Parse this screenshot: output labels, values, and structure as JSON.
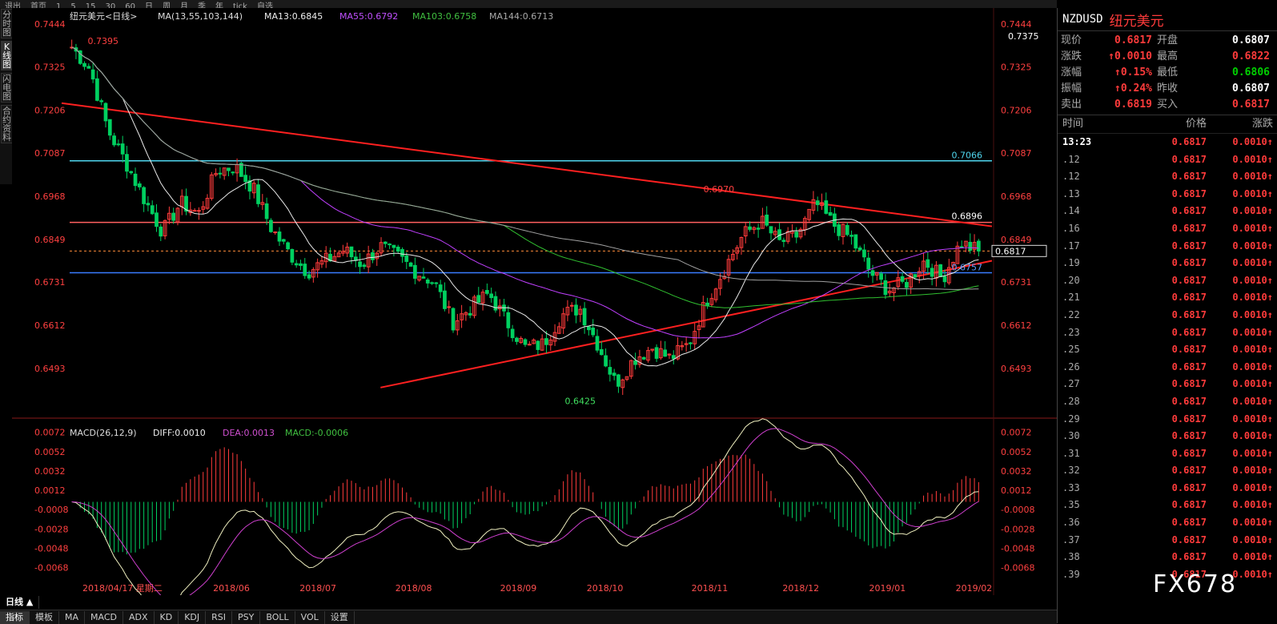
{
  "toolbar": {
    "items": [
      "退出",
      "首页",
      "1",
      "5",
      "15",
      "30",
      "60",
      "日",
      "周",
      "月",
      "季",
      "年",
      "tick",
      "",
      "",
      "",
      "",
      "",
      "",
      "",
      "",
      "",
      "",
      "",
      "自选",
      "",
      "",
      "",
      "",
      "",
      "",
      "",
      "",
      "",
      "",
      "",
      "",
      "",
      "",
      "",
      "",
      "",
      "",
      "",
      "",
      "",
      "",
      "",
      "",
      "",
      "",
      "",
      "",
      "",
      "",
      "",
      "",
      "",
      "",
      "",
      "",
      "",
      "",
      "",
      "",
      "",
      "",
      "",
      "",
      "",
      "",
      "",
      "",
      "",
      "",
      "",
      "",
      "",
      "",
      "",
      "",
      "",
      "",
      "",
      "",
      "",
      "",
      "",
      "",
      "",
      "",
      "",
      "",
      "",
      "",
      "",
      "",
      "",
      "",
      "",
      "",
      "",
      "",
      "",
      "",
      "",
      "",
      "",
      "",
      "",
      "",
      "",
      "",
      "",
      "",
      "",
      "",
      "",
      "",
      "",
      "",
      "",
      "",
      "",
      "",
      "",
      "",
      "",
      "",
      "",
      "",
      "",
      "",
      "",
      "",
      "",
      ""
    ]
  },
  "sidebar": {
    "items": [
      "分时图",
      "K线图",
      "闪电图",
      "合约资料"
    ],
    "active_index": 1
  },
  "main_header": {
    "symbol_name": "纽元美元<日线>",
    "ma_label": "MA(13,55,103,144)",
    "ma13": "MA13:0.6845",
    "ma55": "MA55:0.6792",
    "ma103": "MA103:0.6758",
    "ma144": "MA144:0.6713"
  },
  "macd_header": {
    "label": "MACD(26,12,9)",
    "diff": "DIFF:0.0010",
    "dea": "DEA:0.0013",
    "macd": "MACD:-0.0006"
  },
  "chart_data": {
    "type": "candlestick",
    "price_axis_ticks": [
      0.7444,
      0.7325,
      0.7206,
      0.7087,
      0.6968,
      0.6849,
      0.6731,
      0.6612,
      0.6493
    ],
    "price_range": [
      0.636,
      0.747
    ],
    "macd_axis_ticks": [
      0.0072,
      0.0052,
      0.0032,
      0.0012,
      -0.0008,
      -0.0028,
      -0.0048,
      -0.0068
    ],
    "macd_range": [
      -0.008,
      0.008
    ],
    "x_axis_labels": [
      "2018/04/17 星期二",
      "2018/06",
      "2018/07",
      "2018/08",
      "2018/09",
      "2018/10",
      "2018/11",
      "2018/12",
      "2019/01",
      "2019/02"
    ],
    "annotations": {
      "high": "0.7395",
      "low": "0.6425",
      "peak": "0.6970",
      "resistance_label": "0.6896",
      "support_label": "0.6757",
      "cyan_label": "0.7066",
      "right_label_7375": "0.7375",
      "current_price": "0.6817"
    },
    "horizontal_lines": [
      {
        "price": 0.7066,
        "color": "#4fd6ef"
      },
      {
        "price": 0.6896,
        "color": "#ff6060"
      },
      {
        "price": 0.6757,
        "color": "#3a7cff"
      },
      {
        "price": 0.6817,
        "color": "#ff8a3a",
        "style": "dashed"
      }
    ],
    "trend_lines": [
      {
        "from": [
          0,
          0.7225
        ],
        "to": [
          1,
          0.6885
        ],
        "color": "#ff2020"
      },
      {
        "from": [
          0.35,
          0.644
        ],
        "to": [
          1,
          0.679
        ],
        "color": "#ff2020"
      }
    ],
    "close_anchors": [
      [
        0.0,
        0.738
      ],
      [
        0.02,
        0.732
      ],
      [
        0.04,
        0.715
      ],
      [
        0.06,
        0.706
      ],
      [
        0.08,
        0.696
      ],
      [
        0.1,
        0.687
      ],
      [
        0.12,
        0.695
      ],
      [
        0.14,
        0.692
      ],
      [
        0.16,
        0.704
      ],
      [
        0.18,
        0.705
      ],
      [
        0.2,
        0.699
      ],
      [
        0.22,
        0.688
      ],
      [
        0.24,
        0.681
      ],
      [
        0.26,
        0.676
      ],
      [
        0.28,
        0.679
      ],
      [
        0.3,
        0.682
      ],
      [
        0.32,
        0.678
      ],
      [
        0.34,
        0.683
      ],
      [
        0.36,
        0.68
      ],
      [
        0.38,
        0.676
      ],
      [
        0.4,
        0.673
      ],
      [
        0.42,
        0.662
      ],
      [
        0.44,
        0.666
      ],
      [
        0.46,
        0.67
      ],
      [
        0.48,
        0.662
      ],
      [
        0.5,
        0.655
      ],
      [
        0.52,
        0.656
      ],
      [
        0.54,
        0.664
      ],
      [
        0.56,
        0.666
      ],
      [
        0.58,
        0.656
      ],
      [
        0.6,
        0.645
      ],
      [
        0.62,
        0.652
      ],
      [
        0.64,
        0.655
      ],
      [
        0.66,
        0.652
      ],
      [
        0.68,
        0.656
      ],
      [
        0.7,
        0.668
      ],
      [
        0.72,
        0.677
      ],
      [
        0.74,
        0.686
      ],
      [
        0.76,
        0.69
      ],
      [
        0.78,
        0.684
      ],
      [
        0.8,
        0.686
      ],
      [
        0.82,
        0.695
      ],
      [
        0.84,
        0.689
      ],
      [
        0.86,
        0.685
      ],
      [
        0.88,
        0.676
      ],
      [
        0.9,
        0.671
      ],
      [
        0.92,
        0.673
      ],
      [
        0.94,
        0.679
      ],
      [
        0.96,
        0.674
      ],
      [
        0.98,
        0.684
      ],
      [
        1.0,
        0.6817
      ]
    ],
    "candle_count": 215
  },
  "right_panel": {
    "symbol": "NZDUSD",
    "name": "纽元美元",
    "quote": [
      {
        "l1": "现价",
        "v1": "0.6817",
        "c1": "red",
        "l2": "开盘",
        "v2": "0.6807",
        "c2": "white"
      },
      {
        "l1": "涨跌",
        "v1": "↑0.0010",
        "c1": "red",
        "l2": "最高",
        "v2": "0.6822",
        "c2": "red"
      },
      {
        "l1": "涨幅",
        "v1": "↑0.15%",
        "c1": "red",
        "l2": "最低",
        "v2": "0.6806",
        "c2": "green"
      },
      {
        "l1": "振幅",
        "v1": "↑0.24%",
        "c1": "red",
        "l2": "昨收",
        "v2": "0.6807",
        "c2": "white"
      },
      {
        "l1": "卖出",
        "v1": "0.6819",
        "c1": "red",
        "l2": "买入",
        "v2": "0.6817",
        "c2": "red"
      }
    ],
    "ticks_header": {
      "time": "时间",
      "price": "价格",
      "change": "涨跌"
    },
    "ticks": [
      {
        "t": "13:23",
        "p": "0.6817",
        "c": "0.0010↑"
      },
      {
        "t": ".12",
        "p": "0.6817",
        "c": "0.0010↑"
      },
      {
        "t": ".12",
        "p": "0.6817",
        "c": "0.0010↑"
      },
      {
        "t": ".13",
        "p": "0.6817",
        "c": "0.0010↑"
      },
      {
        "t": ".14",
        "p": "0.6817",
        "c": "0.0010↑"
      },
      {
        "t": ".16",
        "p": "0.6817",
        "c": "0.0010↑"
      },
      {
        "t": ".17",
        "p": "0.6817",
        "c": "0.0010↑"
      },
      {
        "t": ".19",
        "p": "0.6817",
        "c": "0.0010↑"
      },
      {
        "t": ".20",
        "p": "0.6817",
        "c": "0.0010↑"
      },
      {
        "t": ".21",
        "p": "0.6817",
        "c": "0.0010↑"
      },
      {
        "t": ".22",
        "p": "0.6817",
        "c": "0.0010↑"
      },
      {
        "t": ".23",
        "p": "0.6817",
        "c": "0.0010↑"
      },
      {
        "t": ".25",
        "p": "0.6817",
        "c": "0.0010↑"
      },
      {
        "t": ".26",
        "p": "0.6817",
        "c": "0.0010↑"
      },
      {
        "t": ".27",
        "p": "0.6817",
        "c": "0.0010↑"
      },
      {
        "t": ".28",
        "p": "0.6817",
        "c": "0.0010↑"
      },
      {
        "t": ".29",
        "p": "0.6817",
        "c": "0.0010↑"
      },
      {
        "t": ".30",
        "p": "0.6817",
        "c": "0.0010↑"
      },
      {
        "t": ".31",
        "p": "0.6817",
        "c": "0.0010↑"
      },
      {
        "t": ".32",
        "p": "0.6817",
        "c": "0.0010↑"
      },
      {
        "t": ".33",
        "p": "0.6817",
        "c": "0.0010↑"
      },
      {
        "t": ".35",
        "p": "0.6817",
        "c": "0.0010↑"
      },
      {
        "t": ".36",
        "p": "0.6817",
        "c": "0.0010↑"
      },
      {
        "t": ".37",
        "p": "0.6817",
        "c": "0.0010↑"
      },
      {
        "t": ".38",
        "p": "0.6817",
        "c": "0.0010↑"
      },
      {
        "t": ".39",
        "p": "0.6817",
        "c": "0.0010↑"
      }
    ]
  },
  "bottom": {
    "period_button": "日线 ▲",
    "tabs": [
      "指标",
      "模板",
      "MA",
      "MACD",
      "ADX",
      "KD",
      "KDJ",
      "RSI",
      "PSY",
      "BOLL",
      "VOL",
      "设置"
    ],
    "active_tab": 0
  },
  "watermark": "FX678",
  "colors": {
    "up": "#ff3b3b",
    "down": "#00d060",
    "ma13": "#e8e8e8",
    "ma55": "#c040ff",
    "ma103": "#30c030",
    "ma144": "#a0a0a0",
    "dif": "#f0f0c0",
    "dea": "#d040d0"
  }
}
